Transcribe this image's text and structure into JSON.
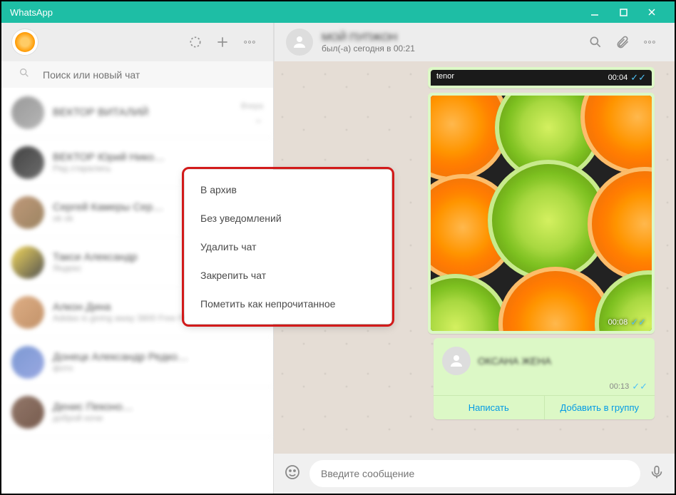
{
  "titlebar": {
    "app_name": "WhatsApp"
  },
  "left_header": {},
  "search": {
    "placeholder": "Поиск или новый чат"
  },
  "chats": [
    {
      "name": "ВЕКТОР ВИТАЛИЙ",
      "preview": " ",
      "time": "Вчера"
    },
    {
      "name": "ВЕКТОР Юрий Нико…",
      "preview": "Ряд старались",
      "time": ""
    },
    {
      "name": "Сергей Камеры Сер…",
      "preview": "ok ok",
      "time": ""
    },
    {
      "name": "Такси Александр",
      "preview": "Яндекс",
      "time": ""
    },
    {
      "name": "Алкон Дина",
      "preview": "Adidas is giving away 3800 Free Pair of…",
      "time": ""
    },
    {
      "name": "Донецк Александр Редко…",
      "preview": "фото",
      "time": ""
    },
    {
      "name": "Денис Пеконо…",
      "preview": "доброй ночи",
      "time": ""
    }
  ],
  "context_menu": {
    "items": [
      "В архив",
      "Без уведомлений",
      "Удалить чат",
      "Закрепить чат",
      "Пометить как непрочитанное"
    ]
  },
  "conversation": {
    "title": "МОЙ ПУПЖОН",
    "subtitle": "был(-а) сегодня в 00:21"
  },
  "messages": {
    "tenor_label": "tenor",
    "tenor_time": "00:04",
    "image_time": "00:08",
    "contact_name": "ОКСАНА ЖЕНА",
    "contact_time": "00:13",
    "action_message": "Написать",
    "action_add": "Добавить в группу"
  },
  "composer": {
    "placeholder": "Введите сообщение"
  }
}
